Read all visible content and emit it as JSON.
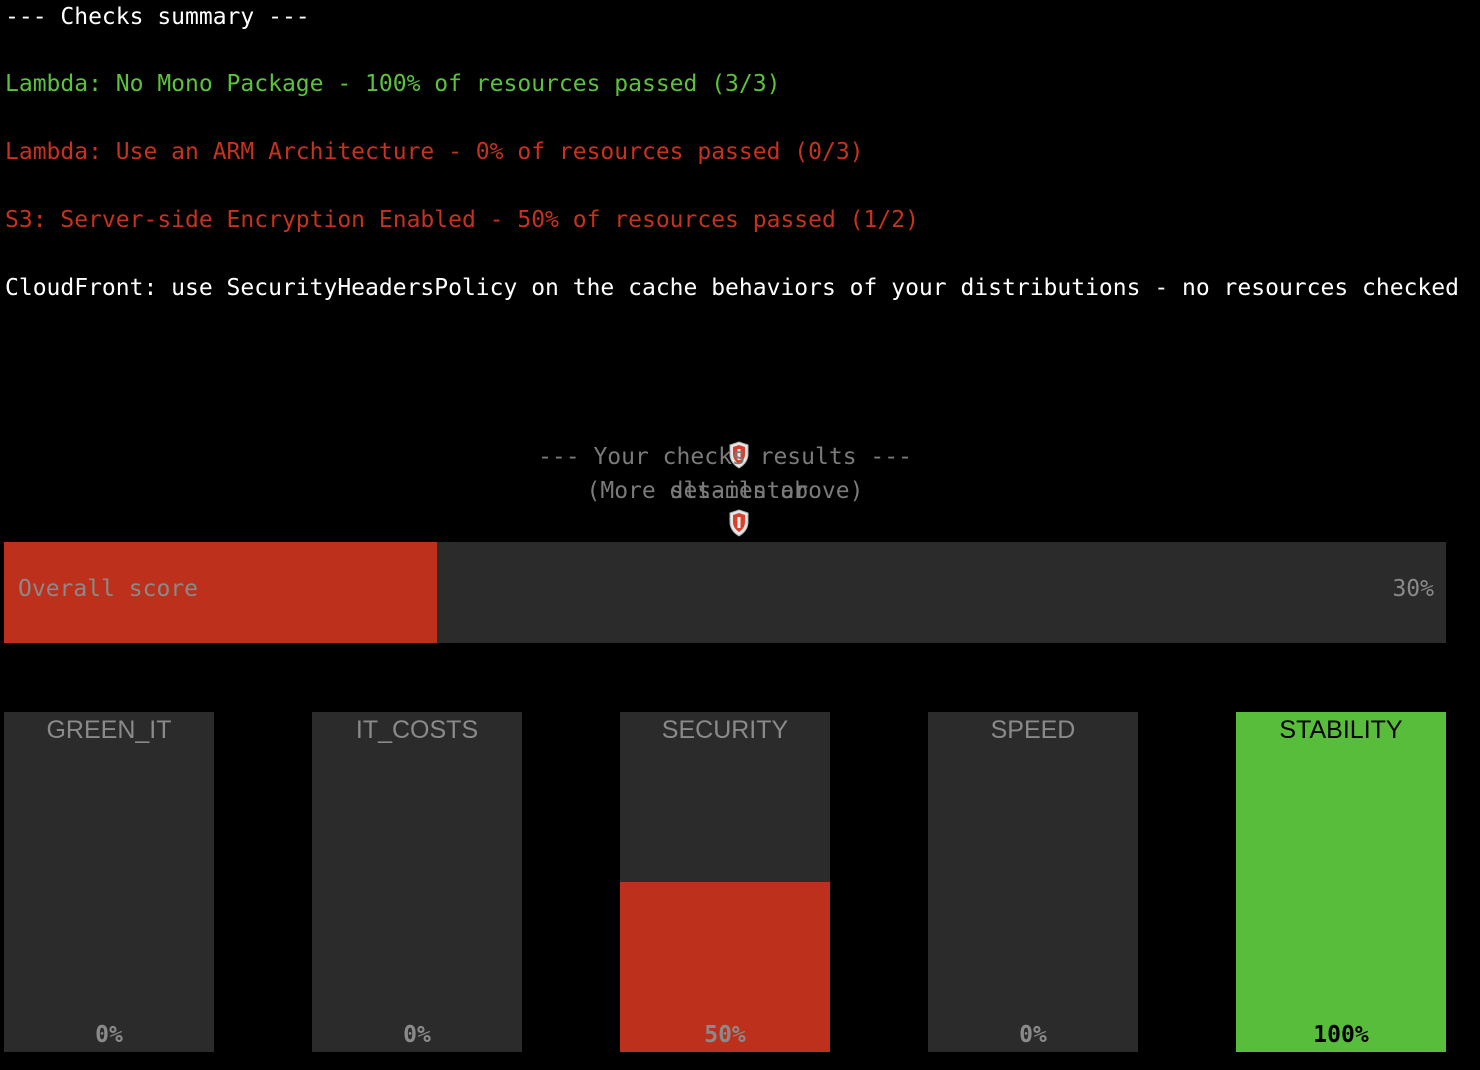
{
  "summary": {
    "header": "--- Checks summary ---",
    "checks": [
      {
        "text": "Lambda: No Mono Package - 100% of resources passed (3/3)",
        "color": "#5cc23a"
      },
      {
        "text": "Lambda: Use an ARM Architecture - 0% of resources passed (0/3)",
        "color": "#c6321d"
      },
      {
        "text": "S3: Server-side Encryption Enabled - 50% of resources passed (1/2)",
        "color": "#c6321d"
      },
      {
        "text": "CloudFront: use SecurityHeadersPolicy on the cache behaviors of your distributions - no resources checked",
        "color": "#ffffff"
      }
    ]
  },
  "banner": {
    "title": "sls-mentor",
    "icon": "shield-icon",
    "subtitle": "--- Your checks results ---",
    "note": "(More details above)"
  },
  "overall": {
    "label": "Overall score",
    "value": 30,
    "value_label": "30%",
    "color": "#bc301c"
  },
  "categories": [
    {
      "name": "GREEN_IT",
      "value": 0,
      "value_label": "0%",
      "color": "#bc301c"
    },
    {
      "name": "IT_COSTS",
      "value": 0,
      "value_label": "0%",
      "color": "#bc301c"
    },
    {
      "name": "SECURITY",
      "value": 50,
      "value_label": "50%",
      "color": "#bc301c"
    },
    {
      "name": "SPEED",
      "value": 0,
      "value_label": "0%",
      "color": "#bc301c"
    },
    {
      "name": "STABILITY",
      "value": 100,
      "value_label": "100%",
      "color": "#57bd3b"
    }
  ],
  "colors": {
    "background": "#000000",
    "track": "#2b2b2b",
    "muted_text": "#8a8a8a"
  }
}
